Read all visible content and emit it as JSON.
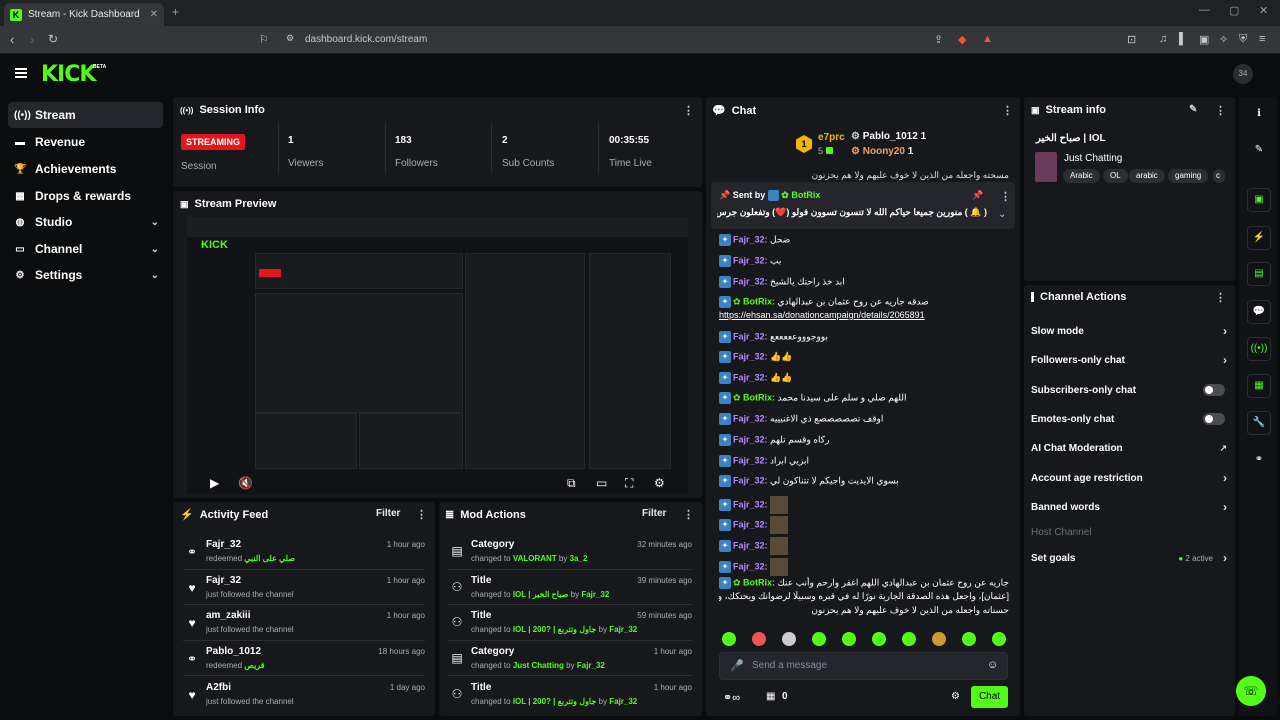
{
  "browser": {
    "tab_title": "Stream - Kick Dashboard",
    "tab_close": "✕",
    "new_tab": "+",
    "url": "dashboard.kick.com/stream"
  },
  "header": {
    "logo": "KICK",
    "beta": "BETA"
  },
  "sidebar": {
    "items": [
      {
        "label": "Stream",
        "icon": "stream-icon"
      },
      {
        "label": "Revenue",
        "icon": "revenue-icon"
      },
      {
        "label": "Achievements",
        "icon": "trophy-icon"
      },
      {
        "label": "Drops & rewards",
        "icon": "gift-icon"
      },
      {
        "label": "Studio",
        "icon": "studio-icon"
      },
      {
        "label": "Channel",
        "icon": "channel-icon"
      },
      {
        "label": "Settings",
        "icon": "gear-icon"
      }
    ]
  },
  "session": {
    "title": "Session Info",
    "status": "STREAMING",
    "status_label": "Session",
    "stats": [
      {
        "value": "1",
        "label": "Viewers"
      },
      {
        "value": "183",
        "label": "Followers"
      },
      {
        "value": "2",
        "label": "Sub Counts"
      },
      {
        "value": "00:35:55",
        "label": "Time Live"
      }
    ]
  },
  "preview": {
    "title": "Stream Preview"
  },
  "activity": {
    "title": "Activity Feed",
    "filter": "Filter",
    "rows": [
      {
        "name": "Fajr_32",
        "sub": "redeemed",
        "highlight": "صلي على النبي",
        "time": "1 hour ago"
      },
      {
        "name": "Fajr_32",
        "sub": "just followed the channel",
        "highlight": "",
        "time": "1 hour ago"
      },
      {
        "name": "am_zakiii",
        "sub": "just followed the channel",
        "highlight": "",
        "time": "1 hour ago"
      },
      {
        "name": "Pablo_1012",
        "sub": "redeemed",
        "highlight": "قريص",
        "time": "18 hours ago"
      },
      {
        "name": "A2fbi",
        "sub": "just followed the channel",
        "highlight": "",
        "time": "1 day ago"
      }
    ]
  },
  "mod": {
    "title": "Mod Actions",
    "filter": "Filter",
    "rows": [
      {
        "name": "Category",
        "prefix": "changed to",
        "value": "VALORANT",
        "by": "by",
        "user": "3a_2",
        "time": "32 minutes ago"
      },
      {
        "name": "Title",
        "prefix": "changed to",
        "value": "IOL | صباح الخير",
        "by": "by",
        "user": "Fajr_32",
        "time": "39 minutes ago"
      },
      {
        "name": "Title",
        "prefix": "changed to",
        "value": "IOL | 200? | جاول وتتربع",
        "by": "by",
        "user": "Fajr_32",
        "time": "59 minutes ago"
      },
      {
        "name": "Category",
        "prefix": "changed to",
        "value": "Just Chatting",
        "by": "by",
        "user": "Fajr_32",
        "time": "1 hour ago"
      },
      {
        "name": "Title",
        "prefix": "changed to",
        "value": "IOL | 200? | جاول وتتربع",
        "by": "by",
        "user": "Fajr_32",
        "time": "1 hour ago"
      }
    ]
  },
  "chat": {
    "title": "Chat",
    "top_gifters": {
      "rank1": "1",
      "u1": "e7prc",
      "u1_count": "5",
      "u2": "Pablo_1012",
      "u2_count": "1",
      "u3": "Noony20",
      "u3_count": "1"
    },
    "pinned": {
      "sent_by": "Sent by",
      "user": "BotRix",
      "text": "( 🔔 ) منورين جميعا حياكم الله لا تنسون تسوون فولو (❤️) وتفعلون جرس الاشعارات"
    },
    "top_partial": "مسحته واجعله من الذين لا خوف عليهم ولا هم يحزنون",
    "messages": [
      {
        "user": "Fajr_32",
        "text": "ضحل",
        "kind": "user"
      },
      {
        "user": "Fajr_32",
        "text": "بب",
        "kind": "user"
      },
      {
        "user": "Fajr_32",
        "text": "ابد خذ راحتك يالشيخ",
        "kind": "user"
      },
      {
        "user": "BotRix",
        "text": "صدقه جاريه عن روح عثمان بن عبدالهادي",
        "kind": "bot"
      },
      {
        "user": "",
        "text": "https://ehsan.sa/donationcampaign/details/2065891",
        "kind": "link"
      },
      {
        "user": "Fajr_32",
        "text": "بووجوووعععععع",
        "kind": "user"
      },
      {
        "user": "Fajr_32",
        "text": "👍👍",
        "kind": "user"
      },
      {
        "user": "Fajr_32",
        "text": "👍👍",
        "kind": "user"
      },
      {
        "user": "BotRix",
        "text": "اللهم صلي و سلم على سيدنا محمد",
        "kind": "bot"
      },
      {
        "user": "Fajr_32",
        "text": "اوقف تصصصصصع ذي الاغنيييه",
        "kind": "user"
      },
      {
        "user": "Fajr_32",
        "text": "ركاه وقسم تلهم",
        "kind": "user"
      },
      {
        "user": "Fajr_32",
        "text": "ابزيي ابراد",
        "kind": "user"
      },
      {
        "user": "Fajr_32",
        "text": "بسوي الايديت واجيكم لا تتناكون لي",
        "kind": "user"
      },
      {
        "user": "Fajr_32",
        "text": "",
        "kind": "img"
      },
      {
        "user": "Fajr_32",
        "text": "",
        "kind": "img"
      },
      {
        "user": "Fajr_32",
        "text": "",
        "kind": "img"
      },
      {
        "user": "Fajr_32",
        "text": "",
        "kind": "img"
      }
    ],
    "bot_last_1": "صدقه جاريه عن روح عثمان بن عبدالهادي اللهم اغفر وارحم وأنب عنك",
    "bot_last_2": "[عثمان]، واجعل هذه الصدقة الجارية نورًا له في قبره وسبيلًا لرضوانك ويحتكك، واجعلها في ميزان",
    "bot_last_3": "حسناته واجعله من الذين لا خوف عليهم ولا هم يحزنون",
    "bot_last_user": "BotRix",
    "input_placeholder": "Send a message",
    "gift_count": "0",
    "send_label": "Chat"
  },
  "stream_info": {
    "title": "Stream info",
    "stream_title": "صباح الخير | IOL",
    "category": "Just Chatting",
    "tags": [
      "Arabic",
      "OL",
      "arabic",
      "gaming",
      "c"
    ]
  },
  "channel_actions": {
    "title": "Channel Actions",
    "items": [
      {
        "label": "Slow mode",
        "ctl": "chevron"
      },
      {
        "label": "Followers-only chat",
        "ctl": "chevron"
      },
      {
        "label": "Subscribers-only chat",
        "ctl": "toggle"
      },
      {
        "label": "Emotes-only chat",
        "ctl": "toggle"
      },
      {
        "label": "AI Chat Moderation",
        "ctl": "external"
      },
      {
        "label": "Account age restriction",
        "ctl": "chevron"
      },
      {
        "label": "Banned words",
        "ctl": "chevron"
      },
      {
        "label": "Host Channel",
        "ctl": "none"
      },
      {
        "label": "Set goals",
        "ctl": "chevron"
      }
    ],
    "goals_active": "2 active"
  },
  "colors": {
    "accent": "#53fc18",
    "live": "#e4151f",
    "username": "#b388ff"
  }
}
